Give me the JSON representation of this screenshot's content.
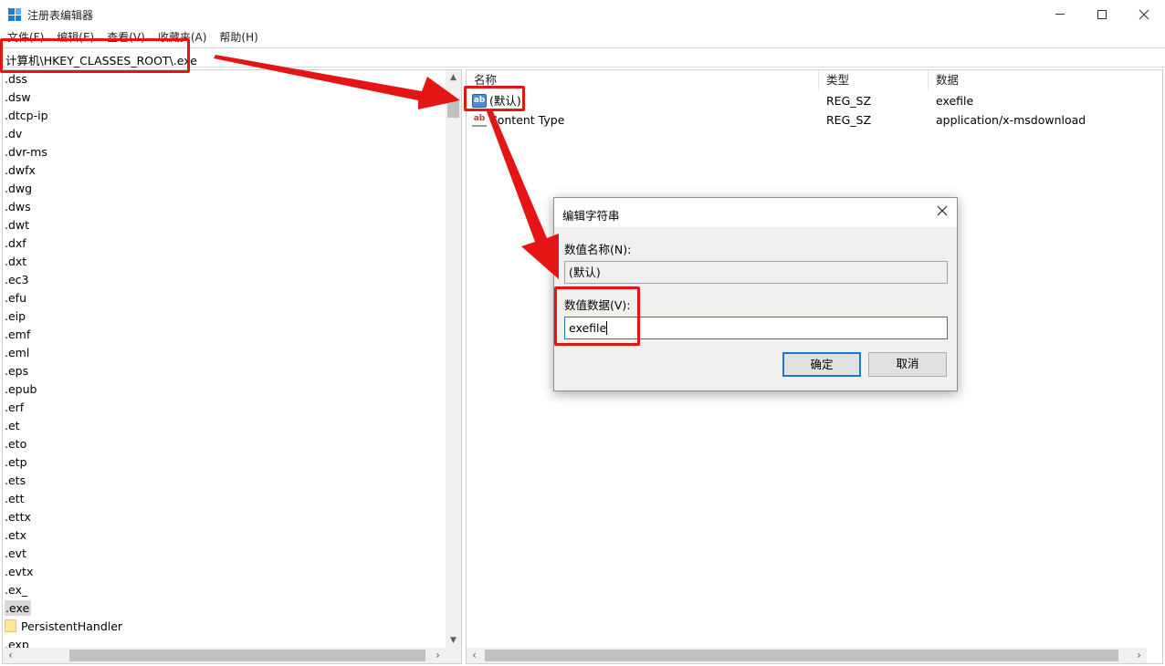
{
  "window": {
    "title": "注册表编辑器"
  },
  "menu": [
    "文件(F)",
    "编辑(E)",
    "查看(V)",
    "收藏夹(A)",
    "帮助(H)"
  ],
  "address": {
    "path": "计算机\\HKEY_CLASSES_ROOT\\.exe"
  },
  "tree": {
    "items": [
      ".dss",
      ".dsw",
      ".dtcp-ip",
      ".dv",
      ".dvr-ms",
      ".dwfx",
      ".dwg",
      ".dws",
      ".dwt",
      ".dxf",
      ".dxt",
      ".ec3",
      ".efu",
      ".eip",
      ".emf",
      ".eml",
      ".eps",
      ".epub",
      ".erf",
      ".et",
      ".eto",
      ".etp",
      ".ets",
      ".ett",
      ".ettx",
      ".etx",
      ".evt",
      ".evtx",
      ".ex_",
      ".exe"
    ],
    "selected": ".exe",
    "child": "PersistentHandler",
    "after": ".exp"
  },
  "values": {
    "columns": [
      "名称",
      "类型",
      "数据"
    ],
    "rows": [
      {
        "name": "(默认)",
        "type": "REG_SZ",
        "data": "exefile",
        "icon": "string-default-icon"
      },
      {
        "name": "Content Type",
        "type": "REG_SZ",
        "data": "application/x-msdownload",
        "icon": "string-value-icon"
      }
    ]
  },
  "dialog": {
    "title": "编辑字符串",
    "name_label": "数值名称(N):",
    "name_value": "(默认)",
    "data_label": "数值数据(V):",
    "data_value": "exefile",
    "ok": "确定",
    "cancel": "取消"
  },
  "colors": {
    "annotation": "#e41515",
    "focus": "#1979ca"
  }
}
